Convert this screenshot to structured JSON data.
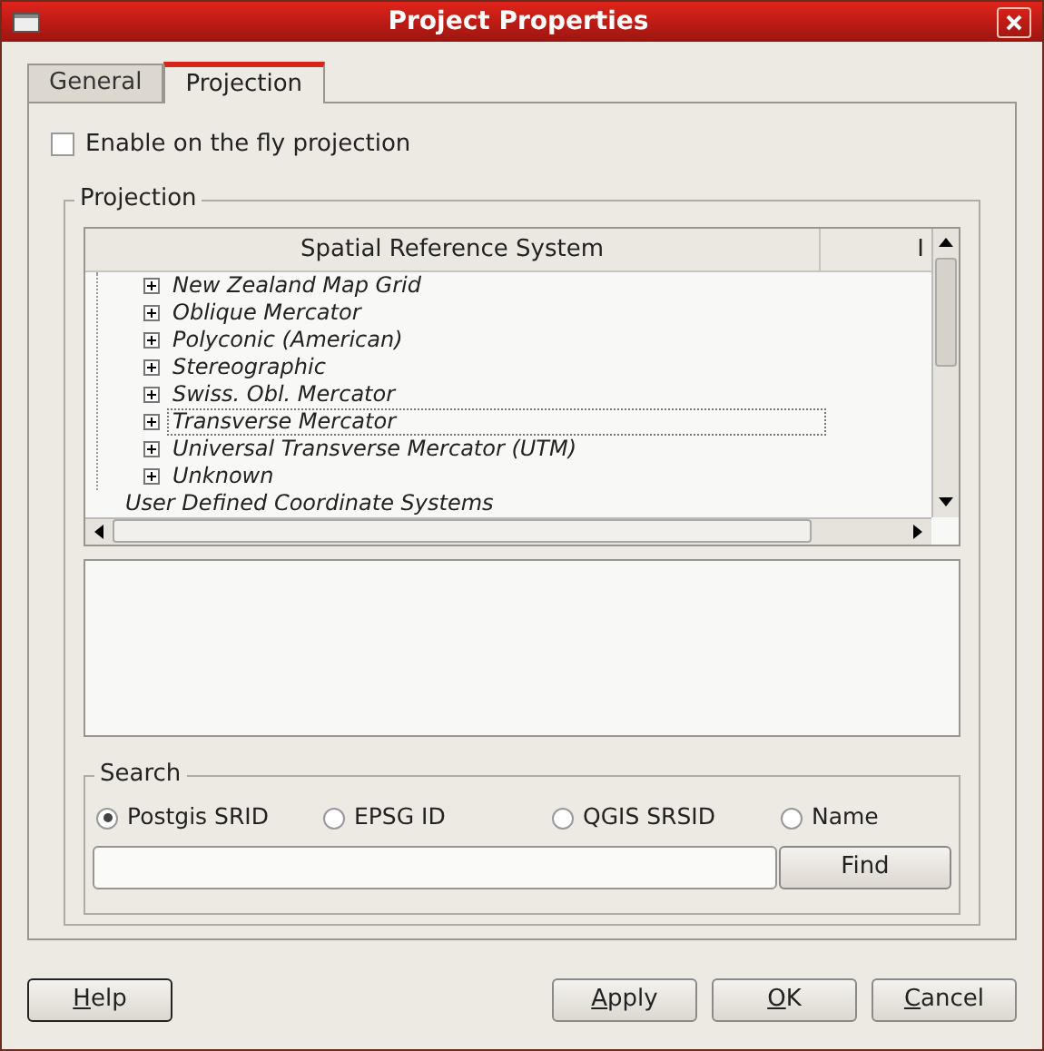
{
  "window": {
    "title": "Project Properties"
  },
  "tabs": [
    {
      "label": "General",
      "selected": false
    },
    {
      "label": "Projection",
      "selected": true
    }
  ],
  "enable_on_the_fly": {
    "label": "Enable on the fly projection",
    "checked": false
  },
  "projection_group": {
    "title": "Projection",
    "table": {
      "columns": [
        "Spatial Reference System",
        "I"
      ],
      "rows": [
        {
          "label": "New Zealand Map Grid",
          "selected": false
        },
        {
          "label": "Oblique Mercator",
          "selected": false
        },
        {
          "label": "Polyconic (American)",
          "selected": false
        },
        {
          "label": "Stereographic",
          "selected": false
        },
        {
          "label": "Swiss. Obl. Mercator",
          "selected": false
        },
        {
          "label": "Transverse Mercator",
          "selected": true
        },
        {
          "label": "Universal Transverse Mercator (UTM)",
          "selected": false
        },
        {
          "label": "Unknown",
          "selected": false
        }
      ],
      "root_row": {
        "label": "User Defined Coordinate Systems"
      }
    }
  },
  "search_group": {
    "title": "Search",
    "options": [
      {
        "label": "Postgis SRID",
        "selected": true
      },
      {
        "label": "EPSG ID",
        "selected": false
      },
      {
        "label": "QGIS SRSID",
        "selected": false
      },
      {
        "label": "Name",
        "selected": false
      }
    ],
    "find_button": "Find"
  },
  "buttons": [
    {
      "label": "Help"
    },
    {
      "label": "Apply"
    },
    {
      "label": "OK"
    },
    {
      "label": "Cancel"
    }
  ]
}
